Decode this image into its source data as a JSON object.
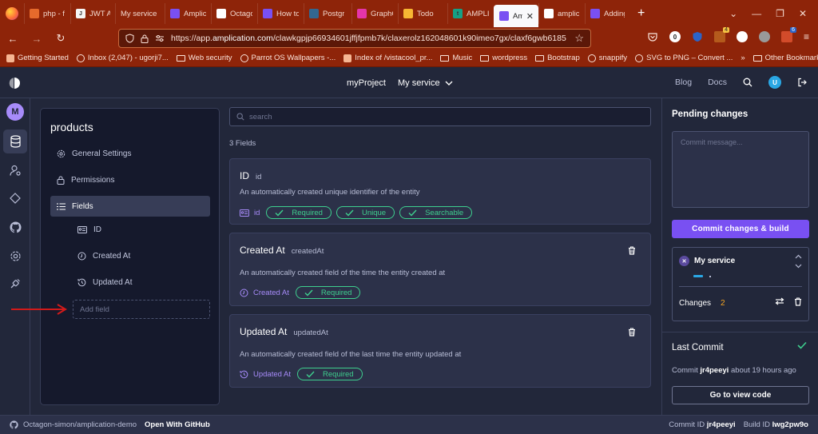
{
  "browser": {
    "tabs": [
      {
        "label": "php - f",
        "fav": "#e66a2c",
        "fav_text": ""
      },
      {
        "label": "JWT Au",
        "fav": "#f5f5f5",
        "fav_text": "J"
      },
      {
        "label": "My service",
        "fav": "",
        "fav_text": ""
      },
      {
        "label": "Amplic",
        "fav": "#7950f2",
        "fav_text": ""
      },
      {
        "label": "Octago",
        "fav": "#ffffff",
        "fav_text": ""
      },
      {
        "label": "How to",
        "fav": "#7950f2",
        "fav_text": ""
      },
      {
        "label": "Postgr",
        "fav": "#336791",
        "fav_text": ""
      },
      {
        "label": "GraphC",
        "fav": "#e535ab",
        "fav_text": ""
      },
      {
        "label": "Todo",
        "fav": "#f7b733",
        "fav_text": ""
      },
      {
        "label": "AMPLI",
        "fav": "#16a085",
        "fav_text": "t"
      },
      {
        "label": "Amp",
        "fav": "#7950f2",
        "fav_text": "",
        "active": true
      },
      {
        "label": "amplic",
        "fav": "#ffffff",
        "fav_text": ""
      },
      {
        "label": "Adding",
        "fav": "#7950f2",
        "fav_text": ""
      }
    ],
    "url": {
      "prefix": "https://app.",
      "host": "amplication.com",
      "path": "/clawkgpjp66934601jffjfpmb7k/claxerolz162048601k90imeo7gx/claxf6gwb6185"
    },
    "bookmarks": [
      {
        "label": "Getting Started",
        "type": "ico"
      },
      {
        "label": "Inbox (2,047) - ugorji7...",
        "type": "globe"
      },
      {
        "label": "Web security",
        "type": "folder"
      },
      {
        "label": "Parrot OS Wallpapers -...",
        "type": "globe"
      },
      {
        "label": "Index of /vistacool_pr...",
        "type": "ico"
      },
      {
        "label": "Music",
        "type": "folder"
      },
      {
        "label": "wordpress",
        "type": "folder"
      },
      {
        "label": "Bootstrap",
        "type": "folder"
      },
      {
        "label": "snappify",
        "type": "globe"
      },
      {
        "label": "SVG to PNG – Convert ...",
        "type": "globe"
      }
    ],
    "other_bookmarks": "Other Bookmarks",
    "badge_count_1": "4",
    "badge_count_2": "6"
  },
  "header": {
    "project": "myProject",
    "service": "My service",
    "blog": "Blog",
    "docs": "Docs",
    "user_initial": "U"
  },
  "rail": {
    "avatar_initial": "M"
  },
  "entity": {
    "title": "products",
    "menu": [
      {
        "label": "General Settings",
        "icon": "gear-icon"
      },
      {
        "label": "Permissions",
        "icon": "lock-icon"
      },
      {
        "label": "Fields",
        "icon": "list-icon",
        "active": true
      }
    ],
    "fields": [
      {
        "label": "ID",
        "icon": "id-icon"
      },
      {
        "label": "Created At",
        "icon": "clock-icon"
      },
      {
        "label": "Updated At",
        "icon": "clock-refresh-icon"
      }
    ],
    "add_field_placeholder": "Add field"
  },
  "main": {
    "search_placeholder": "search",
    "fields_count": "3 Fields",
    "cards": [
      {
        "title": "ID",
        "name": "id",
        "description": "An automatically created unique identifier of the entity",
        "type": "id",
        "tags": [
          "Required",
          "Unique",
          "Searchable"
        ],
        "deletable": false
      },
      {
        "title": "Created At",
        "name": "createdAt",
        "description": "An automatically created field of the time the entity created at",
        "type": "Created At",
        "tags": [
          "Required"
        ],
        "deletable": true
      },
      {
        "title": "Updated At",
        "name": "updatedAt",
        "description": "An automatically created field of the last time the entity updated at",
        "type": "Updated At",
        "tags": [
          "Required"
        ],
        "deletable": true
      }
    ]
  },
  "pending": {
    "title": "Pending changes",
    "commit_placeholder": "Commit message...",
    "commit_button": "Commit changes & build",
    "service_name": "My service",
    "changes_label": "Changes",
    "changes_count": "2"
  },
  "last_commit": {
    "title": "Last Commit",
    "prefix": "Commit",
    "id": "jr4peeyi",
    "time": "about 19 hours ago",
    "view_code": "Go to view code"
  },
  "footer": {
    "repo": "Octagon-simon/amplication-demo",
    "open_github": "Open With GitHub",
    "commit_label": "Commit ID",
    "commit_id": "jr4peeyi",
    "build_label": "Build ID",
    "build_id": "lwg2pw9o"
  },
  "colors": {
    "accent": "#7950f2",
    "success": "#3ecf8e",
    "browser_chrome": "#8e2409"
  }
}
